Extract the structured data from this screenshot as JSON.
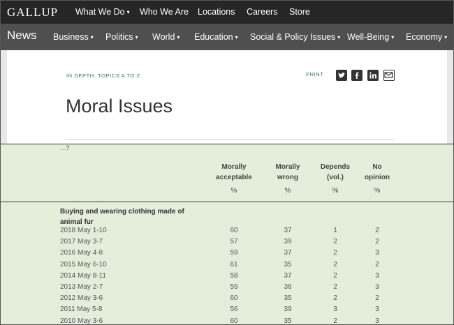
{
  "brand": {
    "logo": "GALLUP"
  },
  "top_nav": {
    "items": [
      {
        "label": "What We Do",
        "dropdown": true
      },
      {
        "label": "Who We Are",
        "dropdown": false
      },
      {
        "label": "Locations",
        "dropdown": false
      },
      {
        "label": "Careers",
        "dropdown": false
      },
      {
        "label": "Store",
        "dropdown": false
      }
    ]
  },
  "sub_nav": {
    "section": "News",
    "items": [
      {
        "label": "Business"
      },
      {
        "label": "Politics"
      },
      {
        "label": "World"
      },
      {
        "label": "Education"
      },
      {
        "label": "Social & Policy Issues"
      },
      {
        "label": "Well-Being"
      },
      {
        "label": "Economy"
      }
    ],
    "caret": "▾"
  },
  "article": {
    "kicker": "IN DEPTH: TOPICS A TO Z",
    "print": "PRINT",
    "title": "Moral Issues",
    "share_icons": [
      "twitter-icon",
      "facebook-icon",
      "linkedin-icon",
      "email-icon"
    ]
  },
  "table": {
    "question_fragment": "...?",
    "columns": [
      {
        "line1": "Morally",
        "line2": "acceptable",
        "unit": "%"
      },
      {
        "line1": "Morally",
        "line2": "wrong",
        "unit": "%"
      },
      {
        "line1": "Depends",
        "line2": "(vol.)",
        "unit": "%"
      },
      {
        "line1": "No",
        "line2": "opinion",
        "unit": "%"
      }
    ],
    "section": "Buying and wearing clothing made of animal fur",
    "rows": [
      {
        "date": "2018 May 1-10",
        "values": [
          "60",
          "37",
          "1",
          "2"
        ]
      },
      {
        "date": "2017 May 3-7",
        "values": [
          "57",
          "39",
          "2",
          "2"
        ]
      },
      {
        "date": "2016 May 4-8",
        "values": [
          "59",
          "37",
          "2",
          "3"
        ]
      },
      {
        "date": "2015 May 6-10",
        "values": [
          "61",
          "35",
          "2",
          "2"
        ]
      },
      {
        "date": "2014 May 8-11",
        "values": [
          "58",
          "37",
          "2",
          "3"
        ]
      },
      {
        "date": "2013 May 2-7",
        "values": [
          "59",
          "36",
          "2",
          "3"
        ]
      },
      {
        "date": "2012 May 3-6",
        "values": [
          "60",
          "35",
          "2",
          "2"
        ]
      },
      {
        "date": "2011 May 5-8",
        "values": [
          "56",
          "39",
          "3",
          "3"
        ]
      },
      {
        "date": "2010 May 3-6",
        "values": [
          "60",
          "35",
          "2",
          "3"
        ]
      }
    ]
  },
  "colors": {
    "top_nav_bg": "#262626",
    "sub_nav_bg": "#4f4f4f",
    "link_green": "#2e7d4f",
    "table_bg": "#e4eedb"
  }
}
